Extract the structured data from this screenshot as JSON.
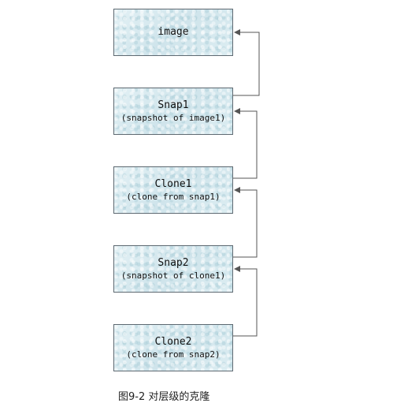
{
  "nodes": [
    {
      "id": "image",
      "title": "image",
      "subtitle": ""
    },
    {
      "id": "snap1",
      "title": "Snap1",
      "subtitle": "(snapshot of image1)"
    },
    {
      "id": "clone1",
      "title": "Clone1",
      "subtitle": "(clone from snap1)"
    },
    {
      "id": "snap2",
      "title": "Snap2",
      "subtitle": "(snapshot of clone1)"
    },
    {
      "id": "clone2",
      "title": "Clone2",
      "subtitle": "(clone from snap2)"
    }
  ],
  "edges": [
    {
      "from": "snap1",
      "to": "image"
    },
    {
      "from": "clone1",
      "to": "snap1"
    },
    {
      "from": "snap2",
      "to": "clone1"
    },
    {
      "from": "clone2",
      "to": "snap2"
    }
  ],
  "caption": "图9-2 对层级的克隆",
  "colors": {
    "node_fill": "#d6eaf0",
    "node_border": "#5f6a72",
    "connector": "#555555"
  }
}
